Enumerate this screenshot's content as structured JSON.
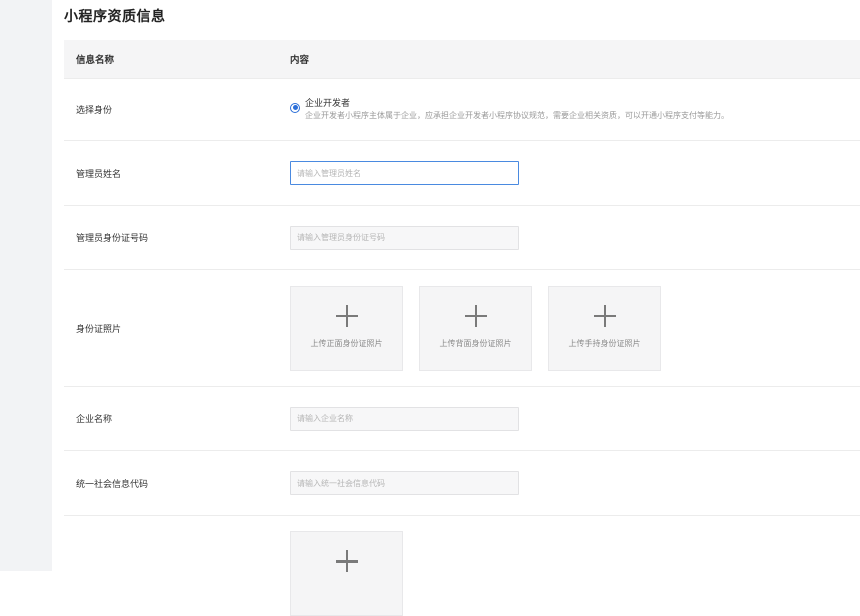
{
  "page": {
    "title": "小程序资质信息"
  },
  "table": {
    "header": {
      "name": "信息名称",
      "content": "内容"
    }
  },
  "identity": {
    "label": "选择身份",
    "option_title": "企业开发者",
    "option_desc": "企业开发者小程序主体属于企业，应承担企业开发者小程序协议规范，需要企业相关资质，可以开通小程序支付等能力。",
    "selected": true
  },
  "admin_name": {
    "label": "管理员姓名",
    "placeholder": "请输入管理员姓名",
    "value": ""
  },
  "admin_id": {
    "label": "管理员身份证号码",
    "placeholder": "请输入管理员身份证号码",
    "value": ""
  },
  "id_photos": {
    "label": "身份证照片",
    "uploads": [
      {
        "label": "上传正面身份证照片"
      },
      {
        "label": "上传背面身份证照片"
      },
      {
        "label": "上传手持身份证照片"
      }
    ]
  },
  "company_name": {
    "label": "企业名称",
    "placeholder": "请输入企业名称",
    "value": ""
  },
  "credit_code": {
    "label": "统一社会信息代码",
    "placeholder": "请输入统一社会信息代码",
    "value": ""
  },
  "colors": {
    "accent": "#2a6ed8",
    "focus_border": "#4a8ae0",
    "header_bg": "#f5f5f6",
    "gutter_bg": "#f2f3f5"
  },
  "icons": {
    "upload": "plus-icon",
    "radio": "radio-selected"
  }
}
